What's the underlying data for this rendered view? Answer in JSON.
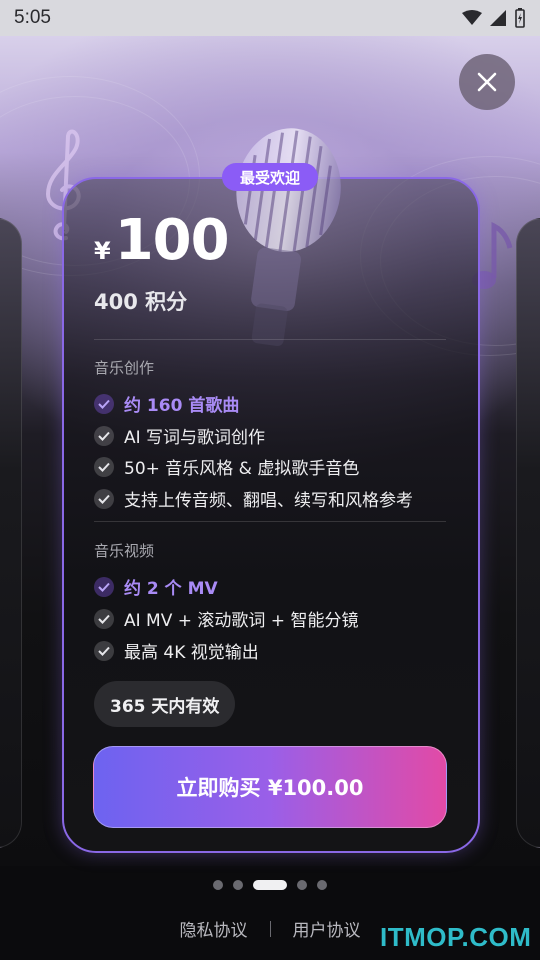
{
  "status_bar": {
    "time": "5:05"
  },
  "plan": {
    "badge": "最受欢迎",
    "currency": "¥",
    "price": "100",
    "points": "400 积分",
    "music_creation": {
      "title": "音乐创作",
      "features": [
        {
          "text": "约 160 首歌曲",
          "highlight": true
        },
        {
          "text": "AI 写词与歌词创作",
          "highlight": false
        },
        {
          "text": "50+ 音乐风格 & 虚拟歌手音色",
          "highlight": false
        },
        {
          "text": "支持上传音频、翻唱、续写和风格参考",
          "highlight": false
        }
      ]
    },
    "music_video": {
      "title": "音乐视频",
      "features": [
        {
          "text": "约 2 个 MV",
          "highlight": true
        },
        {
          "text": "AI MV + 滚动歌词 + 智能分镜",
          "highlight": false
        },
        {
          "text": "最高 4K 视觉输出",
          "highlight": false
        }
      ]
    },
    "validity": "365 天内有效",
    "buy_label": "立即购买 ¥100.00"
  },
  "pager": {
    "count": 5,
    "active_index": 2
  },
  "footer": {
    "privacy": "隐私协议",
    "user_agreement": "用户协议"
  },
  "watermark": "ITMOP.COM",
  "colors": {
    "accent": "#8b5cf6",
    "highlight_text": "#a98bf5",
    "button_start": "#6d63f0",
    "button_end": "#e24aa6"
  },
  "icons": [
    "close-icon",
    "wifi-icon",
    "signal-icon",
    "battery-icon",
    "check-icon",
    "microphone-illustration"
  ]
}
